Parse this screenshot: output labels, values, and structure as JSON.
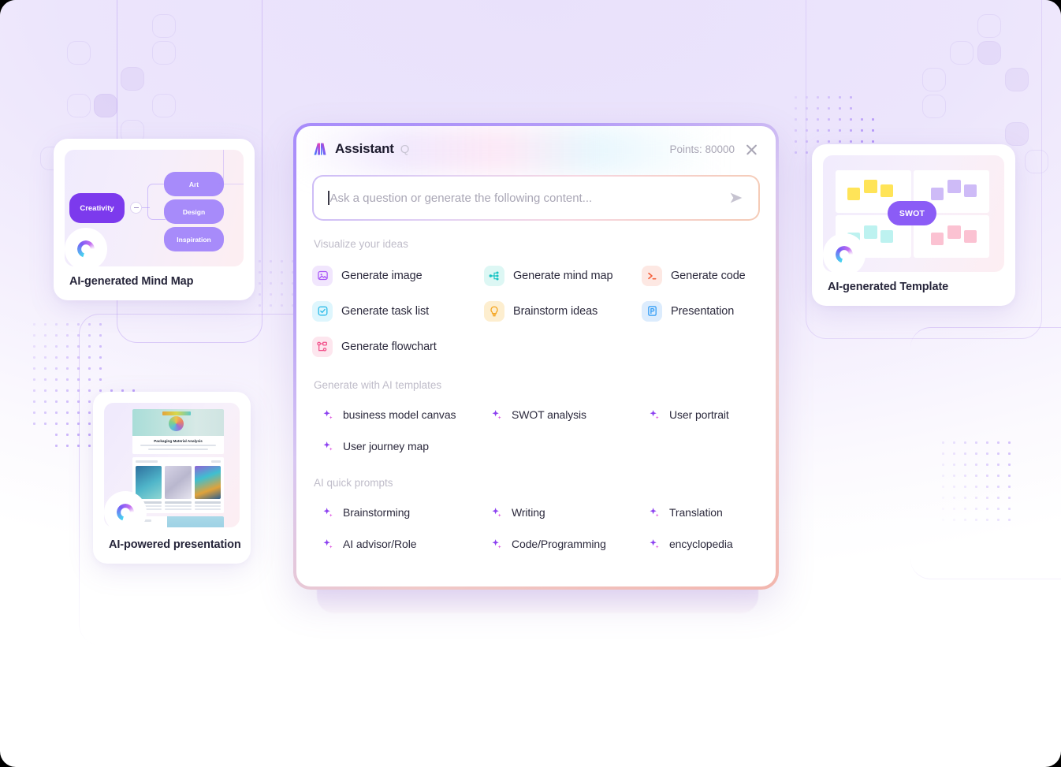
{
  "panel": {
    "logo": "assistant-logo-icon",
    "title": "Assistant",
    "subtitle": "Q",
    "points": "Points: 80000",
    "close": "close-icon",
    "search": {
      "value": "",
      "placeholder": "Ask a question or generate the following content...",
      "send": "send-icon"
    },
    "sections": [
      {
        "id": "visualize",
        "title": "Visualize your ideas",
        "items": [
          {
            "label": "Generate image",
            "icon": "image-icon",
            "bg": "#f1e6fd",
            "fg": "#a855f7"
          },
          {
            "label": "Generate mind map",
            "icon": "mind-map-icon",
            "bg": "#ddf7f4",
            "fg": "#17c3c3"
          },
          {
            "label": "Generate code",
            "icon": "code-icon",
            "bg": "#fde8e3",
            "fg": "#f4613c"
          },
          {
            "label": "Generate task list",
            "icon": "task-list-icon",
            "bg": "#def6fd",
            "fg": "#22b8e8"
          },
          {
            "label": "Brainstorm ideas",
            "icon": "lightbulb-icon",
            "bg": "#fdeecf",
            "fg": "#f5a623"
          },
          {
            "label": "Presentation",
            "icon": "presentation-icon",
            "bg": "#dcecfd",
            "fg": "#2f9bf5"
          },
          {
            "label": "Generate flowchart",
            "icon": "flowchart-icon",
            "bg": "#fde6ee",
            "fg": "#f2538c"
          }
        ]
      },
      {
        "id": "templates",
        "title": "Generate with AI templates",
        "items": [
          {
            "label": "business model canvas",
            "icon": "sparkle-icon"
          },
          {
            "label": "SWOT analysis",
            "icon": "sparkle-icon"
          },
          {
            "label": "User portrait",
            "icon": "sparkle-icon"
          },
          {
            "label": "User journey map",
            "icon": "sparkle-icon"
          }
        ]
      },
      {
        "id": "prompts",
        "title": "AI quick prompts",
        "items": [
          {
            "label": "Brainstorming",
            "icon": "sparkle-icon"
          },
          {
            "label": "Writing",
            "icon": "sparkle-icon"
          },
          {
            "label": "Translation",
            "icon": "sparkle-icon"
          },
          {
            "label": "AI advisor/Role",
            "icon": "sparkle-icon"
          },
          {
            "label": "Code/Programming",
            "icon": "sparkle-icon"
          },
          {
            "label": "encyclopedia",
            "icon": "sparkle-icon"
          }
        ]
      }
    ]
  },
  "cards": {
    "mindmap": {
      "caption": "AI-generated Mind Map",
      "spinner": "loading-spinner-icon",
      "root": "Creativity",
      "children": [
        "Art",
        "Design",
        "Inspiration"
      ],
      "colors": {
        "root": "#7c3aed",
        "child": "#a78bfa"
      }
    },
    "presentation": {
      "caption": "AI-powered presentation",
      "spinner": "loading-spinner-icon",
      "slide_title": "Packaging Material Analysis"
    },
    "template": {
      "caption": "AI-generated Template",
      "spinner": "loading-spinner-icon",
      "badge": "SWOT",
      "quadrant_colors": [
        "#ffe458",
        "#c9b6f7",
        "#bdf2f0",
        "#fbc2d2"
      ]
    }
  }
}
